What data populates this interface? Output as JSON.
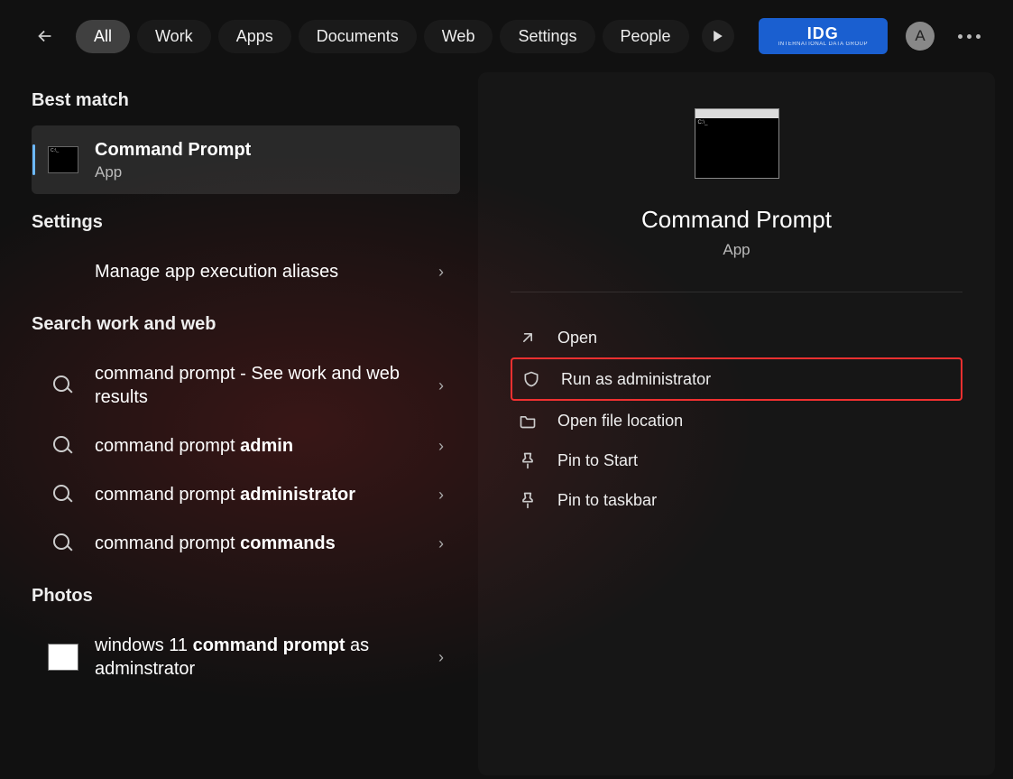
{
  "topbar": {
    "tabs": [
      "All",
      "Work",
      "Apps",
      "Documents",
      "Web",
      "Settings",
      "People"
    ],
    "active_tab": 0,
    "badge": "IDG",
    "badge_sub": "INTERNATIONAL DATA GROUP",
    "avatar_letter": "A"
  },
  "left": {
    "best_match": "Best match",
    "best_match_item": {
      "title": "Command Prompt",
      "subtitle": "App"
    },
    "settings_header": "Settings",
    "settings_items": [
      {
        "label": "Manage app execution aliases"
      }
    ],
    "search_header": "Search work and web",
    "search_items": [
      {
        "prefix": "command prompt",
        "suffix": " - See work and web results",
        "bold": ""
      },
      {
        "prefix": "command prompt ",
        "suffix": "",
        "bold": "admin"
      },
      {
        "prefix": "command prompt ",
        "suffix": "",
        "bold": "administrator"
      },
      {
        "prefix": "command prompt ",
        "suffix": "",
        "bold": "commands"
      }
    ],
    "photos_header": "Photos",
    "photos_items": [
      {
        "prefix": "windows 11 ",
        "bold": "command prompt",
        "suffix": " as adminstrator"
      }
    ]
  },
  "right": {
    "title": "Command Prompt",
    "subtitle": "App",
    "actions": [
      {
        "icon": "open",
        "label": "Open",
        "highlight": false
      },
      {
        "icon": "shield",
        "label": "Run as administrator",
        "highlight": true
      },
      {
        "icon": "folder",
        "label": "Open file location",
        "highlight": false
      },
      {
        "icon": "pin",
        "label": "Pin to Start",
        "highlight": false
      },
      {
        "icon": "pin",
        "label": "Pin to taskbar",
        "highlight": false
      }
    ]
  }
}
